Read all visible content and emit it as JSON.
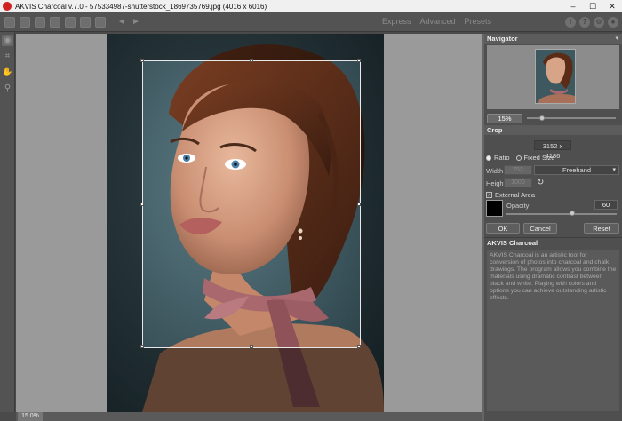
{
  "window": {
    "title": "AKVIS Charcoal v.7.0 - 575334987-shutterstock_1869735769.jpg (4016 x 6016)",
    "min": "–",
    "max": "☐",
    "close": "✕"
  },
  "toolbar": {
    "modes": [
      "Express",
      "Advanced",
      "Presets"
    ],
    "help_icons": [
      "i",
      "?",
      "⚙",
      "●"
    ]
  },
  "canvas": {
    "zoom_status": "15.0%"
  },
  "navigator": {
    "title": "Navigator",
    "zoom": "15%"
  },
  "crop": {
    "title": "Crop",
    "dimensions": "3152 x 4186",
    "ratio_label": "Ratio",
    "fixed_size_label": "Fixed Size",
    "width_label": "Width",
    "height_label": "Height",
    "width_value": "752",
    "height_value": "1000",
    "mode_value": "Freehand",
    "external_area_label": "External Area",
    "external_area_checked": true,
    "opacity_label": "Opacity",
    "opacity_value": "60",
    "opacity_fraction": 0.6,
    "ok_label": "OK",
    "cancel_label": "Cancel",
    "reset_label": "Reset"
  },
  "description": {
    "title": "AKVIS Charcoal",
    "text": "AKVIS Charcoal is an artistic tool for conversion of photos into charcoal and chalk drawings. The program allows you combine the materials using dramatic contrast between black and white. Playing with colors and options you can achieve outstanding artistic effects."
  },
  "colors": {
    "background": "#4a4a4a",
    "photo_backdrop": "#32484f"
  }
}
